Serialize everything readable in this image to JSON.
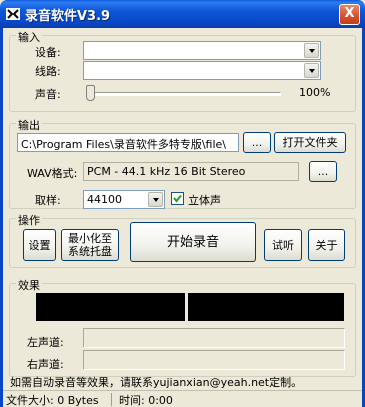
{
  "window": {
    "title": "录音软件V3.9",
    "close_label": "X"
  },
  "input_group": {
    "label": "输入",
    "device_label": "设备:",
    "device_value": "",
    "line_label": "线路:",
    "line_value": "",
    "volume_label": "声音:",
    "volume_value": "100%",
    "volume_level": 0
  },
  "output_group": {
    "label": "输出",
    "path_value": "C:\\Program Files\\录音软件多特专版\\file\\",
    "browse_label": "...",
    "open_folder_label": "打开文件夹",
    "wav_format_label": "WAV格式:",
    "wav_format_value": "PCM - 44.1 kHz 16 Bit Stereo",
    "wav_browse_label": "...",
    "sample_label": "取样:",
    "sample_value": "44100",
    "stereo_label": "立体声",
    "stereo_checked": true
  },
  "operation_group": {
    "label": "操作",
    "settings_label": "设置",
    "minimize_label_1": "最小化至",
    "minimize_label_2": "系统托盘",
    "start_label": "开始录音",
    "listen_label": "试听",
    "about_label": "关于"
  },
  "effects_group": {
    "label": "效果",
    "left_channel_label": "左声道:",
    "right_channel_label": "右声道:"
  },
  "notice": "如需自动录音等效果，请联系yujianxian@yeah.net定制。",
  "statusbar": {
    "file_size": "文件大小: 0 Bytes",
    "time": "时间: 0:00"
  }
}
